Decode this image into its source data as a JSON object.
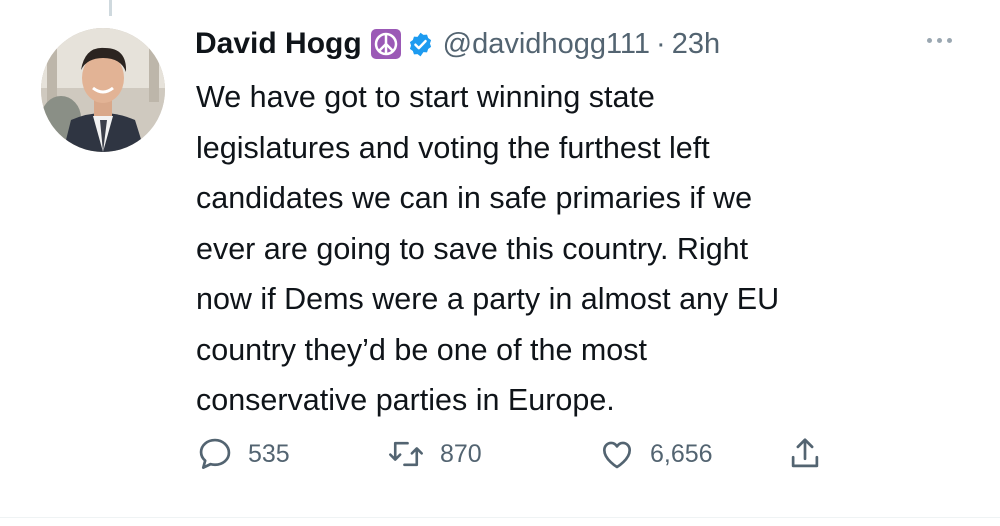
{
  "tweet": {
    "author_name": "David Hogg",
    "handle": "@davidhogg111",
    "separator": "·",
    "time": "23h",
    "text_lines": [
      "We have got to start winning state",
      "legislatures and voting the furthest left",
      "candidates we can in safe primaries if we",
      "ever are going to save this country. Right",
      "now if Dems were a party in almost any EU",
      "country they’d be one of the most",
      "conservative parties in Europe."
    ]
  },
  "actions": {
    "replies": "535",
    "retweets": "870",
    "likes": "6,656"
  },
  "icons": {
    "reply": "reply-icon",
    "retweet": "retweet-icon",
    "like": "heart-icon",
    "share": "share-icon",
    "verified": "verified-badge-icon",
    "peace": "peace-symbol-icon",
    "more": "more-options-icon"
  },
  "colors": {
    "text": "#0f1419",
    "secondary": "#536471",
    "verified_blue": "#1d9bf0",
    "peace_purple": "#9b59b6"
  }
}
